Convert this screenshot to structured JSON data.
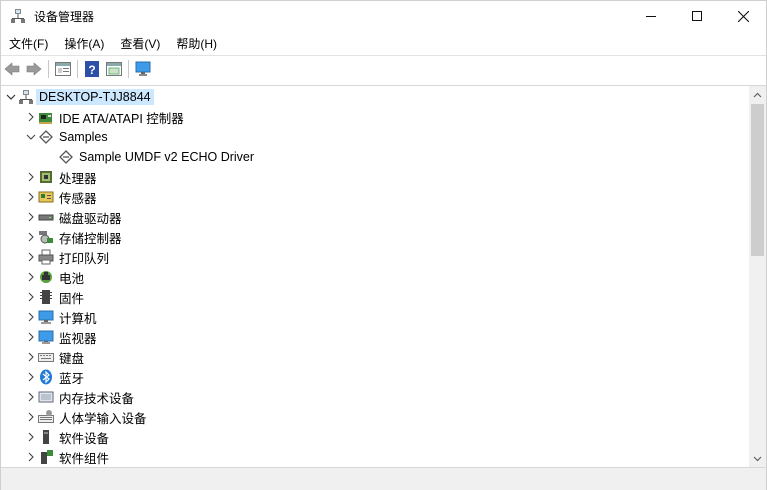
{
  "window": {
    "title": "设备管理器",
    "controls": {
      "minimize": "—",
      "maximize": "☐",
      "close": "✕"
    }
  },
  "menu": [
    "文件(F)",
    "操作(A)",
    "查看(V)",
    "帮助(H)"
  ],
  "toolbar": {
    "buttons": [
      "back-icon",
      "forward-icon",
      "properties-icon",
      "help-icon",
      "update-icon",
      "monitor-icon"
    ]
  },
  "tree": {
    "root": {
      "label": "DESKTOP-TJJ8844",
      "icon": "computer-tree-icon",
      "expanded": true,
      "selected": true
    },
    "items": [
      {
        "label": "IDE ATA/ATAPI 控制器",
        "icon": "ide-controller-icon",
        "expanded": false
      },
      {
        "label": "Samples",
        "icon": "sample-icon",
        "expanded": true,
        "children": [
          {
            "label": "Sample UMDF v2 ECHO Driver",
            "icon": "sample-device-icon"
          }
        ]
      },
      {
        "label": "处理器",
        "icon": "processor-icon",
        "expanded": false
      },
      {
        "label": "传感器",
        "icon": "sensor-icon",
        "expanded": false
      },
      {
        "label": "磁盘驱动器",
        "icon": "disk-drive-icon",
        "expanded": false
      },
      {
        "label": "存储控制器",
        "icon": "storage-controller-icon",
        "expanded": false
      },
      {
        "label": "打印队列",
        "icon": "printer-icon",
        "expanded": false
      },
      {
        "label": "电池",
        "icon": "battery-icon",
        "expanded": false
      },
      {
        "label": "固件",
        "icon": "firmware-icon",
        "expanded": false
      },
      {
        "label": "计算机",
        "icon": "computer-icon",
        "expanded": false
      },
      {
        "label": "监视器",
        "icon": "monitor-icon",
        "expanded": false
      },
      {
        "label": "键盘",
        "icon": "keyboard-icon",
        "expanded": false
      },
      {
        "label": "蓝牙",
        "icon": "bluetooth-icon",
        "expanded": false
      },
      {
        "label": "内存技术设备",
        "icon": "memory-device-icon",
        "expanded": false
      },
      {
        "label": "人体学输入设备",
        "icon": "hid-icon",
        "expanded": false
      },
      {
        "label": "软件设备",
        "icon": "software-device-icon",
        "expanded": false
      },
      {
        "label": "软件组件",
        "icon": "software-component-icon",
        "expanded": false
      }
    ]
  },
  "colors": {
    "selection": "#cce8ff",
    "bluetooth": "#1e7ad6",
    "monitor": "#3d9be9"
  }
}
